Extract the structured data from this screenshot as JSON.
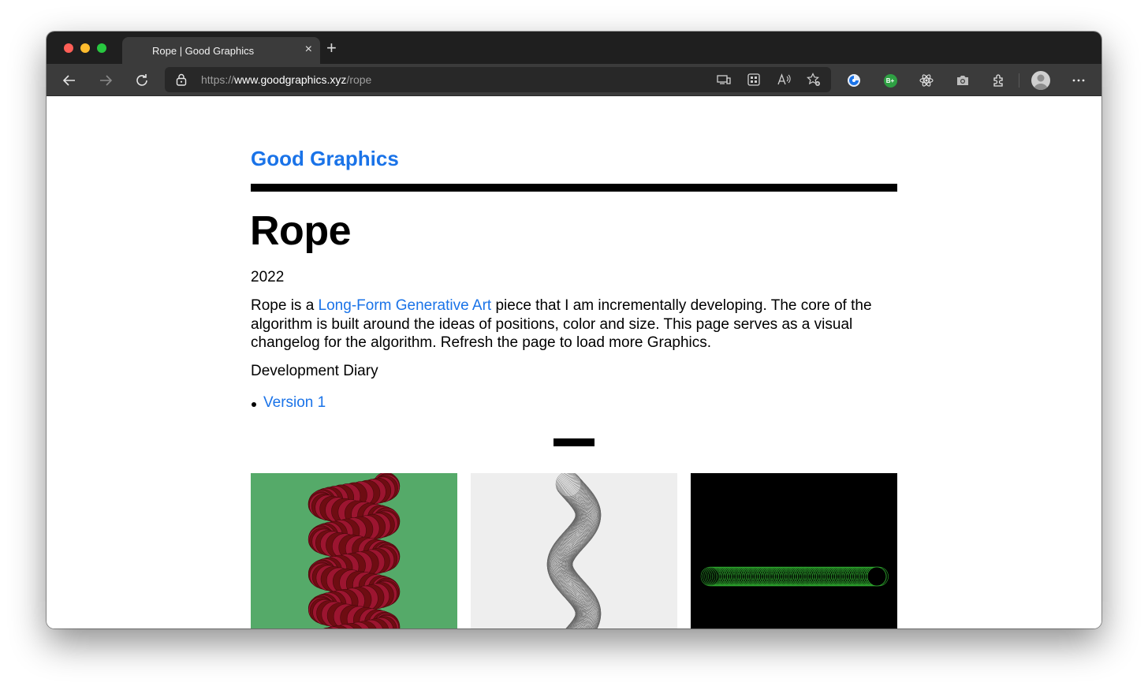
{
  "browser": {
    "tab": {
      "title": "Rope | Good Graphics",
      "close_glyph": "×"
    },
    "new_tab_glyph": "+",
    "address": {
      "scheme": "https://",
      "host": "www.goodgraphics.xyz",
      "path": "/rope"
    },
    "extension_badge": "B+",
    "icons": [
      "back-icon",
      "forward-icon",
      "reload-icon",
      "lock-icon",
      "cast-icon",
      "apps-icon",
      "read-aloud-icon",
      "favorite-icon",
      "edge-extension-icon",
      "react-icon",
      "camera-icon",
      "extensions-icon",
      "avatar",
      "more-icon"
    ]
  },
  "page": {
    "brand": "Good Graphics",
    "title": "Rope",
    "year": "2022",
    "description": {
      "before": "Rope is a ",
      "link": "Long-Form Generative Art",
      "after": " piece that I am incrementally developing. The core of the algorithm is built around the ideas of positions, color and size. This page serves as a visual changelog for the algorithm. Refresh the page to load more Graphics."
    },
    "diary_heading": "Development Diary",
    "versions": [
      "Version 1"
    ],
    "thumbnails": [
      {
        "background": "#55aa69",
        "accent": "#9c1530"
      },
      {
        "background": "#eeeeee",
        "accent": "#666666"
      },
      {
        "background": "#000000",
        "accent": "#2fa82f"
      }
    ]
  }
}
